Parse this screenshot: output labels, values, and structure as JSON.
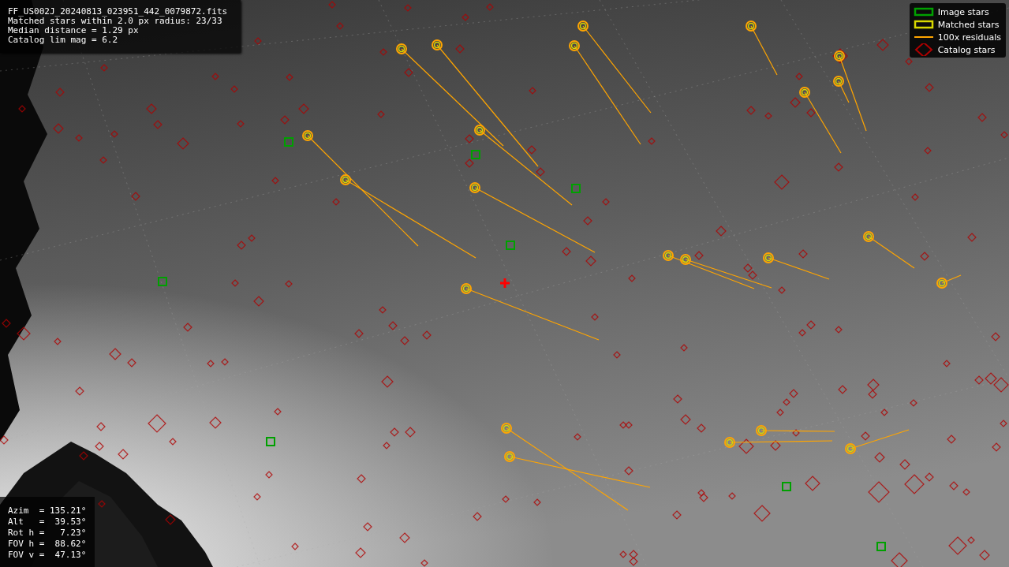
{
  "info_lines": [
    "FF_US002J_20240813_023951_442_0079872.fits",
    "Matched stars within 2.0 px radius: 23/33",
    "Median distance = 1.29 px",
    "Catalog lim mag = 6.2"
  ],
  "pointing_lines": [
    "Azim  = 135.21°",
    "Alt   =  39.53°",
    "Rot h =   7.23°",
    "FOV h =  88.62°",
    "FOV v =  47.13°"
  ],
  "legend": [
    {
      "kind": "square",
      "label": "Image stars",
      "color": "#00a000"
    },
    {
      "kind": "square",
      "label": "Matched stars",
      "color": "#d8d800"
    },
    {
      "kind": "line",
      "label": "100x residuals",
      "color": "#ffa500"
    },
    {
      "kind": "diamond",
      "label": "Catalog stars",
      "color": "#b00000"
    }
  ]
}
